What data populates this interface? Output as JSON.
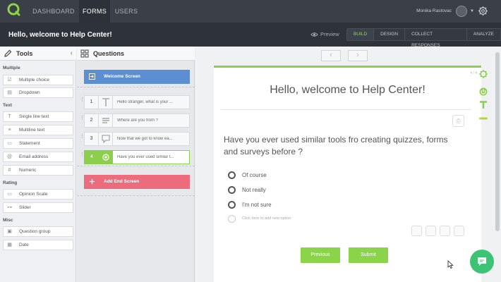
{
  "topnav": {
    "logo_text": "QUIZ",
    "tabs": [
      {
        "label": "DASHBOARD",
        "active": false
      },
      {
        "label": "FORMS",
        "active": true
      },
      {
        "label": "USERS",
        "active": false
      }
    ],
    "user_name": "Monika Rastovac"
  },
  "subbar": {
    "title": "Hello, welcome to Help Center!",
    "preview_label": "Preview",
    "modes": [
      {
        "label": "BUILD",
        "active": true
      },
      {
        "label": "DESIGN",
        "active": false
      },
      {
        "label": "COLLECT RESPONSES",
        "active": false
      },
      {
        "label": "ANALYZE",
        "active": false
      }
    ]
  },
  "tools": {
    "title": "Tools",
    "groups": [
      {
        "label": "Multiple",
        "items": [
          {
            "label": "Multiple choice",
            "icon": "checkbox-icon"
          },
          {
            "label": "Dropdown",
            "icon": "dropdown-icon"
          }
        ]
      },
      {
        "label": "Text",
        "items": [
          {
            "label": "Single line text",
            "icon": "text-t-icon"
          },
          {
            "label": "Multiline text",
            "icon": "lines-icon"
          },
          {
            "label": "Statement",
            "icon": "speech-icon"
          },
          {
            "label": "Email address",
            "icon": "at-icon"
          },
          {
            "label": "Numeric",
            "icon": "hash-icon"
          }
        ]
      },
      {
        "label": "Rating",
        "items": [
          {
            "label": "Opinion Scale",
            "icon": "scale-icon"
          },
          {
            "label": "Slider",
            "icon": "slider-icon"
          }
        ]
      },
      {
        "label": "Misc",
        "items": [
          {
            "label": "Question group",
            "icon": "group-icon"
          },
          {
            "label": "Date",
            "icon": "calendar-icon"
          }
        ]
      }
    ]
  },
  "questions": {
    "title": "Questions",
    "welcome_label": "Welcome Screen",
    "end_label": "Add End Screen",
    "items": [
      {
        "num": "1",
        "text": "Hello stranger, what is your ...",
        "type_icon": "text-t-icon"
      },
      {
        "num": "2",
        "text": "Where are you from ?",
        "type_icon": "lines-icon"
      },
      {
        "num": "3",
        "text": "Now that we got to know ea...",
        "type_icon": "speech-icon"
      },
      {
        "num": "4",
        "text": "Have you ever used similar t...",
        "type_icon": "radio-icon"
      }
    ]
  },
  "canvas": {
    "counter": "4 / 4",
    "card_title": "Hello, welcome to Help Center!",
    "question": "Have you ever used similar tools fro creating quizzes, forms and surveys before ?",
    "options": [
      "Of course",
      "Not really",
      "I'm not sure"
    ],
    "add_option_placeholder": "Click here to add new option",
    "prev_label": "Previous",
    "submit_label": "Submit"
  },
  "colors": {
    "accent_green": "#8ccf4d",
    "welcome_blue": "#5b8fd1",
    "end_red": "#ec6b7c",
    "chat_green": "#3cc474",
    "nav_dark": "#3b4048"
  }
}
